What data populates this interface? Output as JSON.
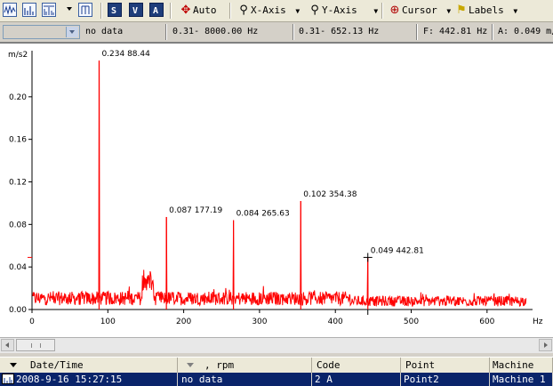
{
  "toolbar": {
    "icons": [
      "waveform-icon",
      "spectrum-icon",
      "spectrum-compare-icon",
      "harmonic-icon",
      "scale-x-icon",
      "scale-y-icon",
      "scale-auto-icon"
    ],
    "auto_label": "Auto",
    "xaxis_label": "X-Axis",
    "yaxis_label": "Y-Axis",
    "cursor_label": "Cursor",
    "labels_label": "Labels"
  },
  "statusbar": {
    "combo_value": "",
    "speed_text": "no data",
    "freq_range_full": "0.31- 8000.00 Hz",
    "freq_range_view": "0.31- 652.13 Hz",
    "cursor_freq": "F: 442.81 Hz",
    "cursor_amp": "A: 0.049 m/"
  },
  "chart_data": {
    "type": "line",
    "ylabel": "m/s2",
    "xlabel": "Hz",
    "xlim": [
      0,
      660
    ],
    "ylim": [
      0,
      0.24
    ],
    "x_ticks": [
      0,
      100,
      200,
      300,
      400,
      500,
      600
    ],
    "y_ticks": [
      0.0,
      0.04,
      0.08,
      0.12,
      0.16,
      0.2
    ],
    "y_tick_labels": [
      "0.00",
      "0.04",
      "0.08",
      "0.12",
      "0.16",
      "0.20"
    ],
    "series": [
      {
        "color": "#ff0000",
        "peaks": [
          {
            "x": 88.44,
            "y": 0.234
          },
          {
            "x": 177.19,
            "y": 0.087
          },
          {
            "x": 265.63,
            "y": 0.084
          },
          {
            "x": 354.38,
            "y": 0.102
          },
          {
            "x": 442.81,
            "y": 0.049
          }
        ]
      }
    ],
    "annotations": [
      {
        "text": "0.234   88.44",
        "x": 88.44,
        "y": 0.234
      },
      {
        "text": "0.087   177.19",
        "x": 177.19,
        "y": 0.087
      },
      {
        "text": "0.084   265.63",
        "x": 265.63,
        "y": 0.084
      },
      {
        "text": "0.102   354.38",
        "x": 354.38,
        "y": 0.102
      },
      {
        "text": "0.049   442.81",
        "x": 442.81,
        "y": 0.049
      }
    ],
    "cursor": {
      "x": 442.81,
      "y": 0.049
    }
  },
  "table": {
    "columns": [
      "Date/Time",
      ", rpm",
      "Code",
      "Point",
      "Machine"
    ],
    "rows": [
      [
        "2008-9-16 15:27:15",
        "no data",
        "2 A",
        "Point2",
        "Machine 1"
      ]
    ]
  }
}
